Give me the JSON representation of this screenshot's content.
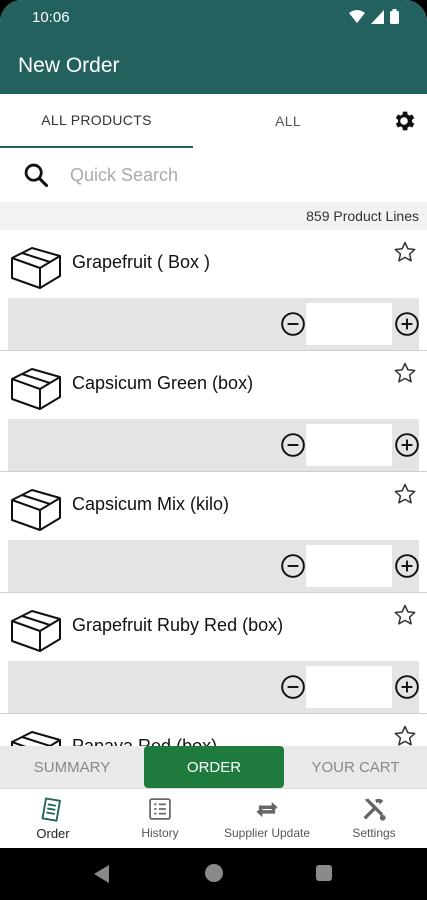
{
  "status_bar": {
    "time": "10:06"
  },
  "app_bar": {
    "title": "New Order"
  },
  "tabs": [
    {
      "label": "ALL PRODUCTS",
      "active": true
    },
    {
      "label": "ALL",
      "active": false
    }
  ],
  "search": {
    "placeholder": "Quick Search",
    "value": ""
  },
  "product_count": "859 Product Lines",
  "products": [
    {
      "name": "Grapefruit ( Box )",
      "quantity": ""
    },
    {
      "name": "Capsicum Green (box)",
      "quantity": ""
    },
    {
      "name": "Capsicum Mix (kilo)",
      "quantity": ""
    },
    {
      "name": "Grapefruit Ruby Red (box)",
      "quantity": ""
    },
    {
      "name": "Papaya Red (box)",
      "quantity": ""
    }
  ],
  "segments": [
    {
      "label": "SUMMARY",
      "active": false
    },
    {
      "label": "ORDER",
      "active": true
    },
    {
      "label": "YOUR CART",
      "active": false
    }
  ],
  "bottom_nav": [
    {
      "label": "Order",
      "icon": "order-icon",
      "active": true
    },
    {
      "label": "History",
      "icon": "history-icon",
      "active": false
    },
    {
      "label": "Supplier Update",
      "icon": "sync-icon",
      "active": false
    },
    {
      "label": "Settings",
      "icon": "tools-icon",
      "active": false
    }
  ],
  "colors": {
    "primary": "#22615e",
    "accent": "#1f7a3d",
    "row_bg": "#e4e4e4"
  }
}
